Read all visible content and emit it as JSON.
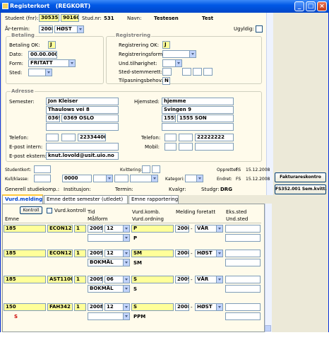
{
  "window": {
    "title": "Registerkort",
    "subtitle": "(REGKORT)",
    "min": "_",
    "max": "□",
    "close": "×"
  },
  "student": {
    "label": "Student (fnr):",
    "fnr1": "305358",
    "fnr2": "90160",
    "studnr_label": "Stud.nr:",
    "studnr": "531",
    "navn_label": "Navn:",
    "etternavn": "Testesen",
    "fornavn": "Test"
  },
  "artermin": {
    "label": "År-termin:",
    "year": "2008",
    "term": "HØST",
    "ugyldig_label": "Ugyldig:"
  },
  "betaling": {
    "group": "Betaling",
    "ok_label": "Betaling OK:",
    "ok": "J",
    "dato_label": "Dato:",
    "dato": "00.00.0000",
    "form_label": "Form:",
    "form": "FRITATT",
    "sted_label": "Sted:",
    "sted": ""
  },
  "registrering": {
    "group": "Registrering",
    "ok_label": "Registrering OK:",
    "ok": "J",
    "form_label": "Registreringsform:",
    "und_label": "Und.tilhørighet:",
    "sted_label": "Sted-stemmerett:",
    "tilp_label": "Tilpasningsbehov:",
    "tilp": "N"
  },
  "adresse": {
    "group": "Adresse",
    "sem_label": "Semester:",
    "sem_name": "Jon Kleiser",
    "sem_street": "Thaulows vei 8",
    "sem_postnr": "0369",
    "sem_sted": "0369 OSLO",
    "hj_label": "Hjemsted:",
    "hj_name": "hjemme",
    "hj_street": "Svingen 9",
    "hj_postnr": "1555",
    "hj_sted": "1555 SON",
    "tlf_label": "Telefon:",
    "tlf": "22334400",
    "tlf2_label": "Telefon:",
    "tlf2": "22222222",
    "mobil_label": "Mobil:",
    "epi_label": "E-post intern:",
    "epe_label": "E-post ekstern:",
    "epe": "knut.lovold@usit.uio.no"
  },
  "misc": {
    "studentkort": "Studentkort:",
    "kvittering": "Kvittering:",
    "opprettet_label": "Opprettet:",
    "opprettet_by": "FS",
    "opprettet_date": "15.12.2008",
    "kullklasse": "Kull/klasse:",
    "kull_val": "0000",
    "kategori": "Kategori:",
    "endret_label": "Endret:",
    "endret_by": "FS",
    "endret_date": "15.12.2008",
    "generell": "Generell studiekomp.:",
    "institusjon": "Institusjon:",
    "termin": "Termin:",
    "kvalgr": "Kvalgr:",
    "studgr_label": "Studgr:",
    "studgr": "DRG"
  },
  "buttons": {
    "faktura": "Fakturareskontro",
    "semkvitt": "FS352.001 Sem.kvitt."
  },
  "tabs": [
    "Vurd.melding",
    "Emne dette semester (utledet)",
    "Emne rapportering"
  ],
  "grid": {
    "kontroll": "Kontroll",
    "vurd_kontroll": "Vurd.kontroll",
    "h_emne": "Emne",
    "h_tid": "Tid",
    "h_maalform": "Målform",
    "h_vkomb": "Vurd.komb.",
    "h_vord": "Vurd.ordning",
    "h_melding": "Melding foretatt",
    "h_eks": "Eks.sted",
    "h_und": "Und.sted",
    "rows": [
      {
        "inst": "185",
        "emne": "ECON1220",
        "ver": "1",
        "year": "2009",
        "month": "12",
        "vkomb": "P",
        "maalform": "",
        "vord": "P",
        "myear": "2008",
        "mterm": "VÅR",
        "flag": ""
      },
      {
        "inst": "185",
        "emne": "ECON1220",
        "ver": "1",
        "year": "2009",
        "month": "12",
        "vkomb": "SM",
        "maalform": "BOKMÅL",
        "vord": "SM",
        "myear": "2008",
        "mterm": "HØST",
        "flag": ""
      },
      {
        "inst": "185",
        "emne": "AST1100",
        "ver": "1",
        "year": "2009",
        "month": "06",
        "vkomb": "S",
        "maalform": "BOKMÅL",
        "vord": "S",
        "myear": "2009",
        "mterm": "VÅR",
        "flag": ""
      },
      {
        "inst": "150",
        "emne": "FAH342",
        "ver": "1",
        "year": "2008",
        "month": "12",
        "vkomb": "S",
        "maalform": "",
        "vord": "PPM",
        "myear": "2008",
        "mterm": "HØST",
        "flag": "S"
      }
    ]
  }
}
